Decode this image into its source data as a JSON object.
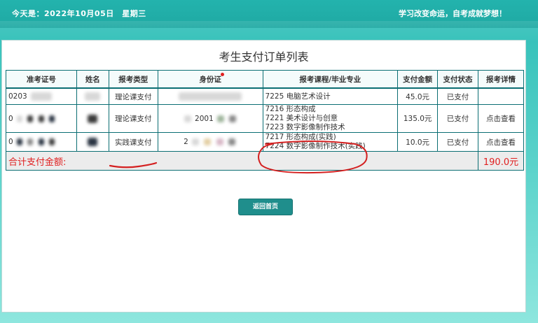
{
  "header": {
    "date_text": "今天是：2022年10月05日　星期三",
    "slogan": "学习改变命运，自考成就梦想！"
  },
  "page": {
    "title": "考生支付订单列表",
    "back_button": "返回首页"
  },
  "table": {
    "headers": [
      "准考证号",
      "姓名",
      "报考类型",
      "身份证",
      "报考课程/毕业专业",
      "支付金额",
      "支付状态",
      "报考详情"
    ],
    "rows": [
      {
        "exam_id": "0203",
        "name": "",
        "type": "理论课支付",
        "id_card": "",
        "courses": [
          "7225 电脑艺术设计"
        ],
        "amount": "45.0元",
        "status": "已支付",
        "detail": ""
      },
      {
        "exam_id": "0",
        "name": "",
        "type": "理论课支付",
        "id_card": "2001",
        "courses": [
          "7216 形态构成",
          "7221 美术设计与创意",
          "7223 数字影像制作技术"
        ],
        "amount": "135.0元",
        "status": "已支付",
        "detail": "点击查看"
      },
      {
        "exam_id": "0",
        "name": "",
        "type": "实践课支付",
        "id_card": "2",
        "courses": [
          "7217 形态构成(实践)",
          "7224 数字影像制作技术(实践)"
        ],
        "amount": "10.0元",
        "status": "已支付",
        "detail": "点击查看"
      }
    ],
    "total_label": "合计支付金额:",
    "total_value": "190.0元"
  },
  "colors": {
    "accent": "#1f8e8c",
    "total": "#e02020",
    "annotation": "#d42020"
  }
}
